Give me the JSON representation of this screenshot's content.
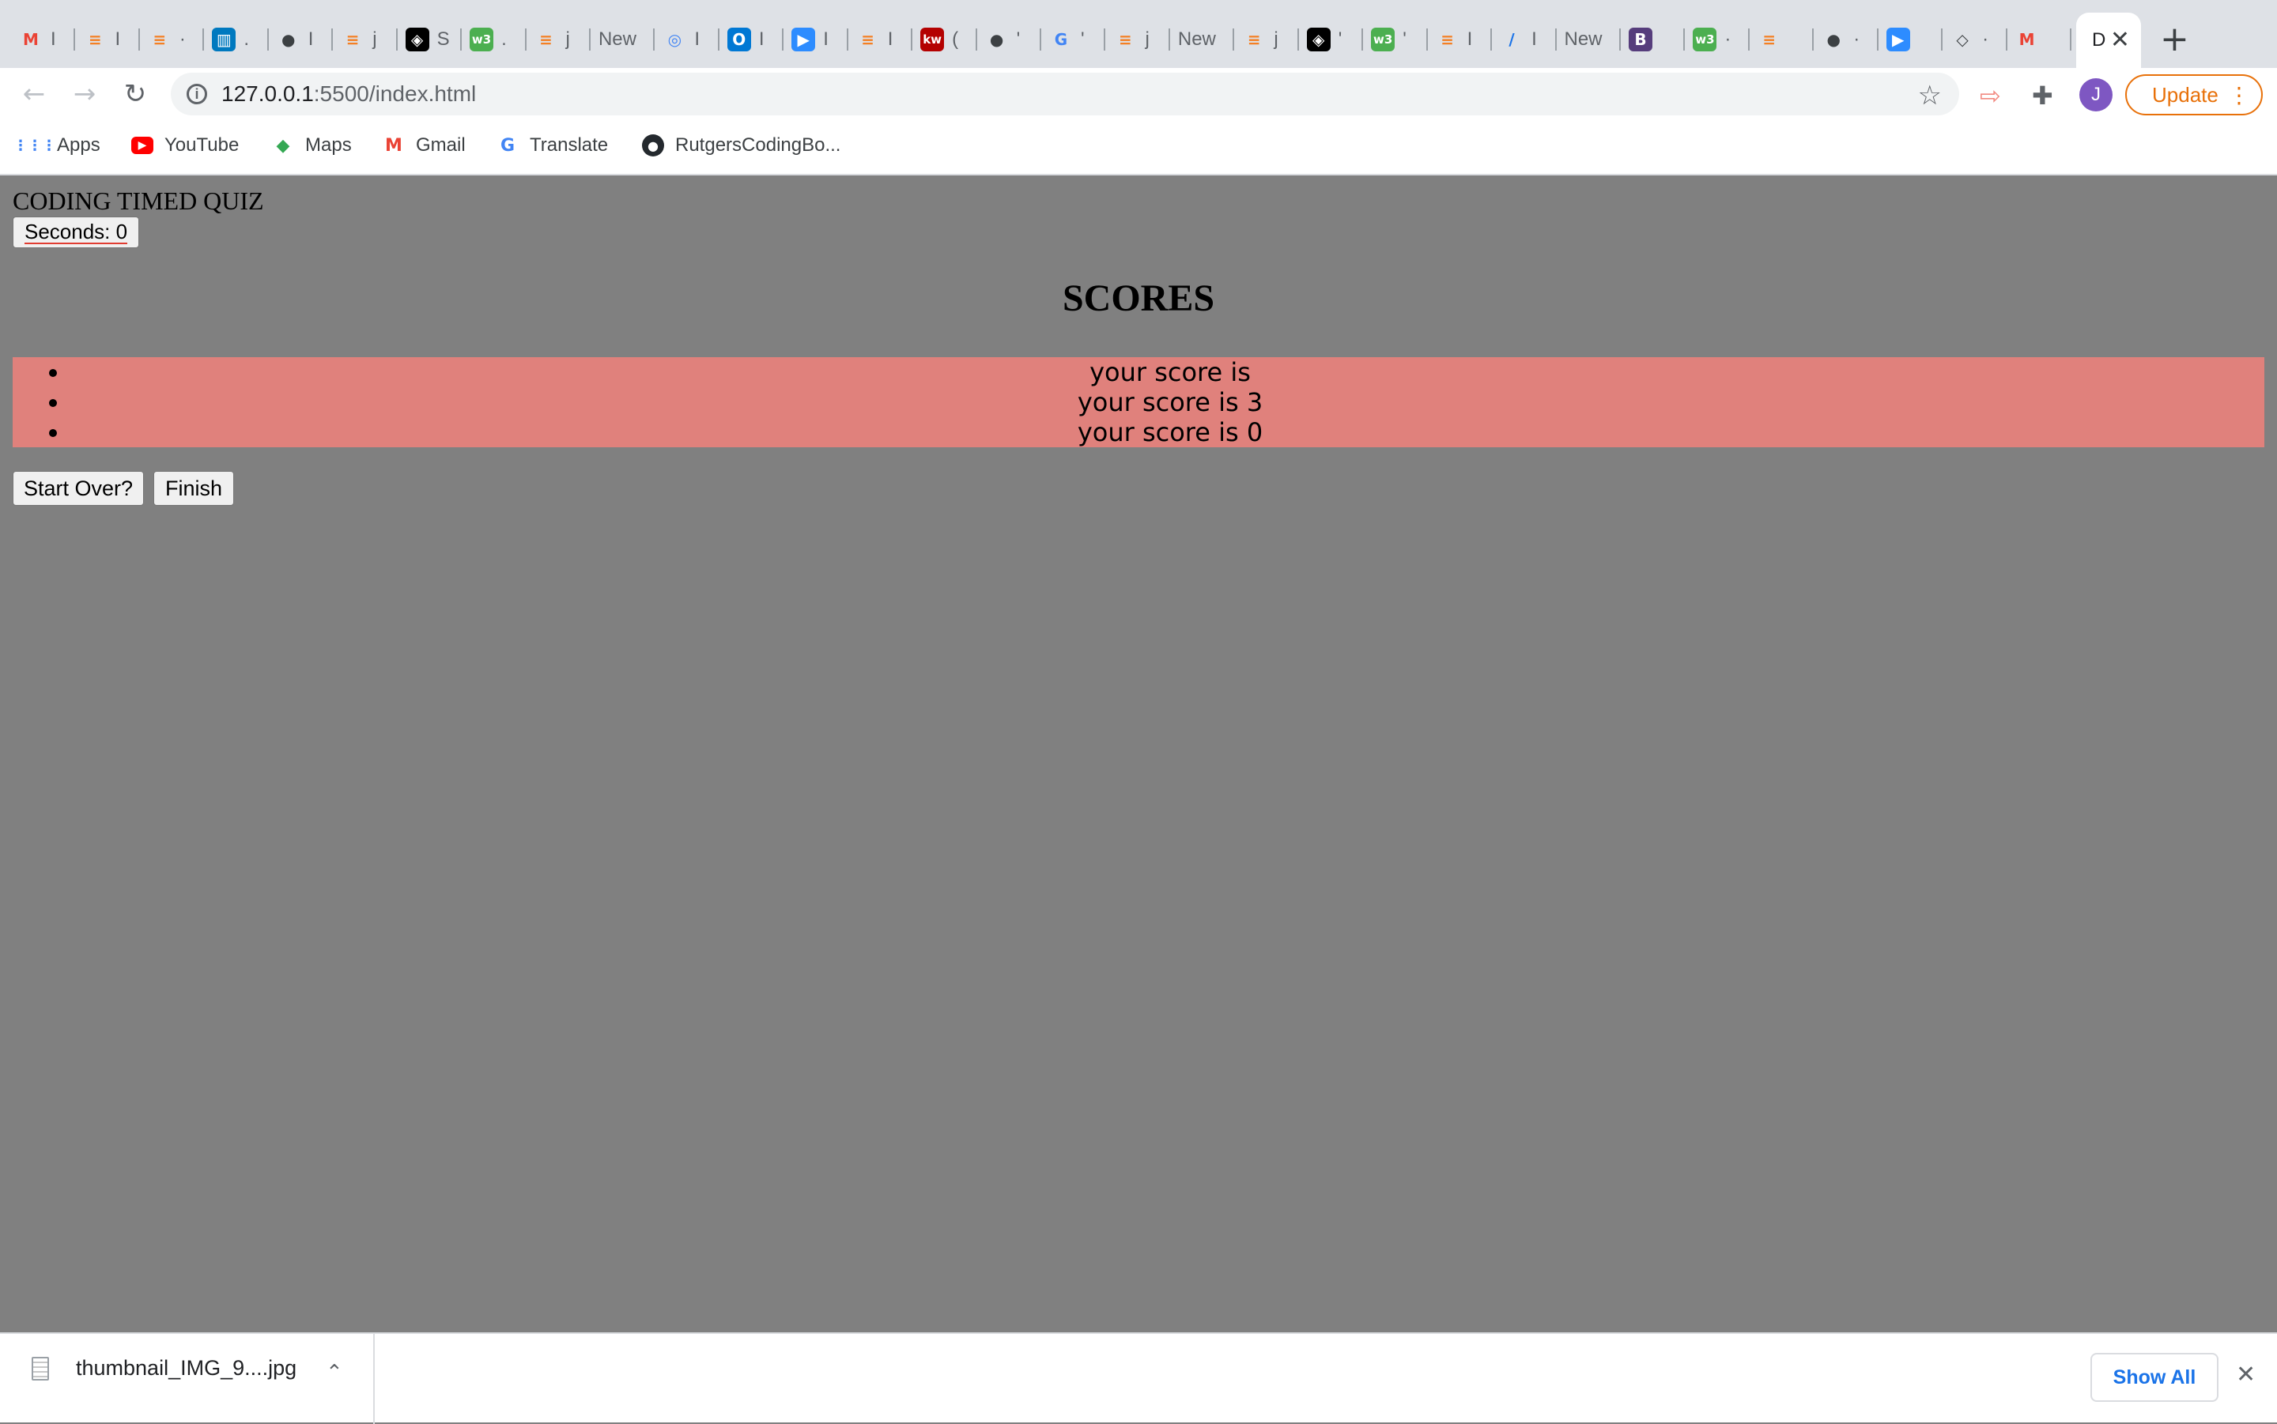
{
  "browser": {
    "tabs": [
      {
        "icon": "gmail-icon",
        "frag": "I",
        "color": "#ea4335"
      },
      {
        "icon": "stackoverflow-icon",
        "frag": "I",
        "color": "#f48024"
      },
      {
        "icon": "stackoverflow-icon",
        "frag": "·",
        "color": "#f48024"
      },
      {
        "icon": "trello-icon",
        "frag": ".",
        "color": "#0079bf"
      },
      {
        "icon": "globe-icon",
        "frag": "I",
        "color": "#3c4043"
      },
      {
        "icon": "stackoverflow-icon",
        "frag": "j",
        "color": "#f48024"
      },
      {
        "icon": "codepen-icon",
        "frag": "S",
        "color": "#000000"
      },
      {
        "icon": "w3schools-icon",
        "frag": ".",
        "color": "#4caf50"
      },
      {
        "icon": "stackoverflow-icon",
        "frag": "j",
        "color": "#f48024"
      },
      {
        "icon": "",
        "frag": "New",
        "color": "#ffffff"
      },
      {
        "icon": "spiral-icon",
        "frag": "I",
        "color": "#4285f4"
      },
      {
        "icon": "outlook-icon",
        "frag": "I",
        "color": "#0078d4"
      },
      {
        "icon": "zoom-icon",
        "frag": "I",
        "color": "#2d8cff"
      },
      {
        "icon": "stackoverflow-icon",
        "frag": "I",
        "color": "#f48024"
      },
      {
        "icon": "kw-icon",
        "frag": "(",
        "color": "#b40101"
      },
      {
        "icon": "globe-icon",
        "frag": "'",
        "color": "#3c4043"
      },
      {
        "icon": "google-icon",
        "frag": "'",
        "color": "#4285f4"
      },
      {
        "icon": "stackoverflow-icon",
        "frag": "j",
        "color": "#f48024"
      },
      {
        "icon": "",
        "frag": "New",
        "color": "#ffffff"
      },
      {
        "icon": "stackoverflow-icon",
        "frag": "j",
        "color": "#f48024"
      },
      {
        "icon": "codepen-icon",
        "frag": "'",
        "color": "#000000"
      },
      {
        "icon": "w3schools-icon",
        "frag": "'",
        "color": "#4caf50"
      },
      {
        "icon": "stackoverflow-icon",
        "frag": "I",
        "color": "#f48024"
      },
      {
        "icon": "slash-icon",
        "frag": "I",
        "color": "#1a73e8"
      },
      {
        "icon": "",
        "frag": "New",
        "color": "#ffffff"
      },
      {
        "icon": "bootstrap-icon",
        "frag": "",
        "color": "#563d7c"
      },
      {
        "icon": "w3schools-icon",
        "frag": "·",
        "color": "#4caf50"
      },
      {
        "icon": "stackoverflow-icon",
        "frag": "",
        "color": "#f48024"
      },
      {
        "icon": "globe-icon",
        "frag": "·",
        "color": "#3c4043"
      },
      {
        "icon": "zoom-icon",
        "frag": "",
        "color": "#2d8cff"
      },
      {
        "icon": "diamond-icon",
        "frag": "·",
        "color": "#3c4043"
      },
      {
        "icon": "gmail-icon",
        "frag": "",
        "color": "#ea4335"
      }
    ],
    "active_tab_label": "D",
    "url_host": "127.0.0.1",
    "url_path": ":5500/index.html",
    "avatar_letter": "J",
    "update_label": "Update",
    "bookmarks": [
      {
        "label": "Apps",
        "icon": "apps-grid-icon"
      },
      {
        "label": "YouTube",
        "icon": "youtube-icon"
      },
      {
        "label": "Maps",
        "icon": "maps-icon"
      },
      {
        "label": "Gmail",
        "icon": "gmail-icon"
      },
      {
        "label": "Translate",
        "icon": "translate-icon"
      },
      {
        "label": "RutgersCodingBo...",
        "icon": "github-icon"
      }
    ]
  },
  "page": {
    "app_title": "CODING TIMED QUIZ",
    "timer_label": "Seconds: 0",
    "scores_heading": "SCORES",
    "scores": [
      "your score is",
      "your score is 3",
      "your score is 0"
    ],
    "start_over_label": "Start Over?",
    "finish_label": "Finish",
    "list_background": "#e0817c",
    "page_background": "#808080"
  },
  "downloads": {
    "file_name": "thumbnail_IMG_9....jpg",
    "show_all_label": "Show All"
  }
}
